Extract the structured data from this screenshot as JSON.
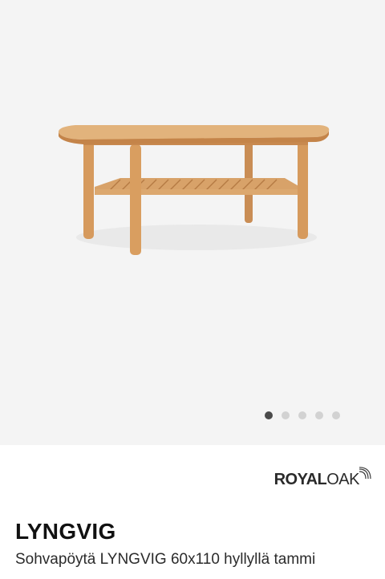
{
  "gallery": {
    "image_alt": "LYNGVIG coffee table",
    "slide_count": 5,
    "active_slide": 1
  },
  "brand": {
    "name_bold": "ROYAL",
    "name_light": "OAK"
  },
  "product": {
    "name": "LYNGVIG",
    "description": "Sohvapöytä LYNGVIG 60x110 hyllyllä tammi"
  },
  "colors": {
    "gallery_background": "#f4f4f4",
    "wood": "#d9a066",
    "dot_active": "#4a4a4a",
    "dot_inactive": "#d2d2d2"
  }
}
